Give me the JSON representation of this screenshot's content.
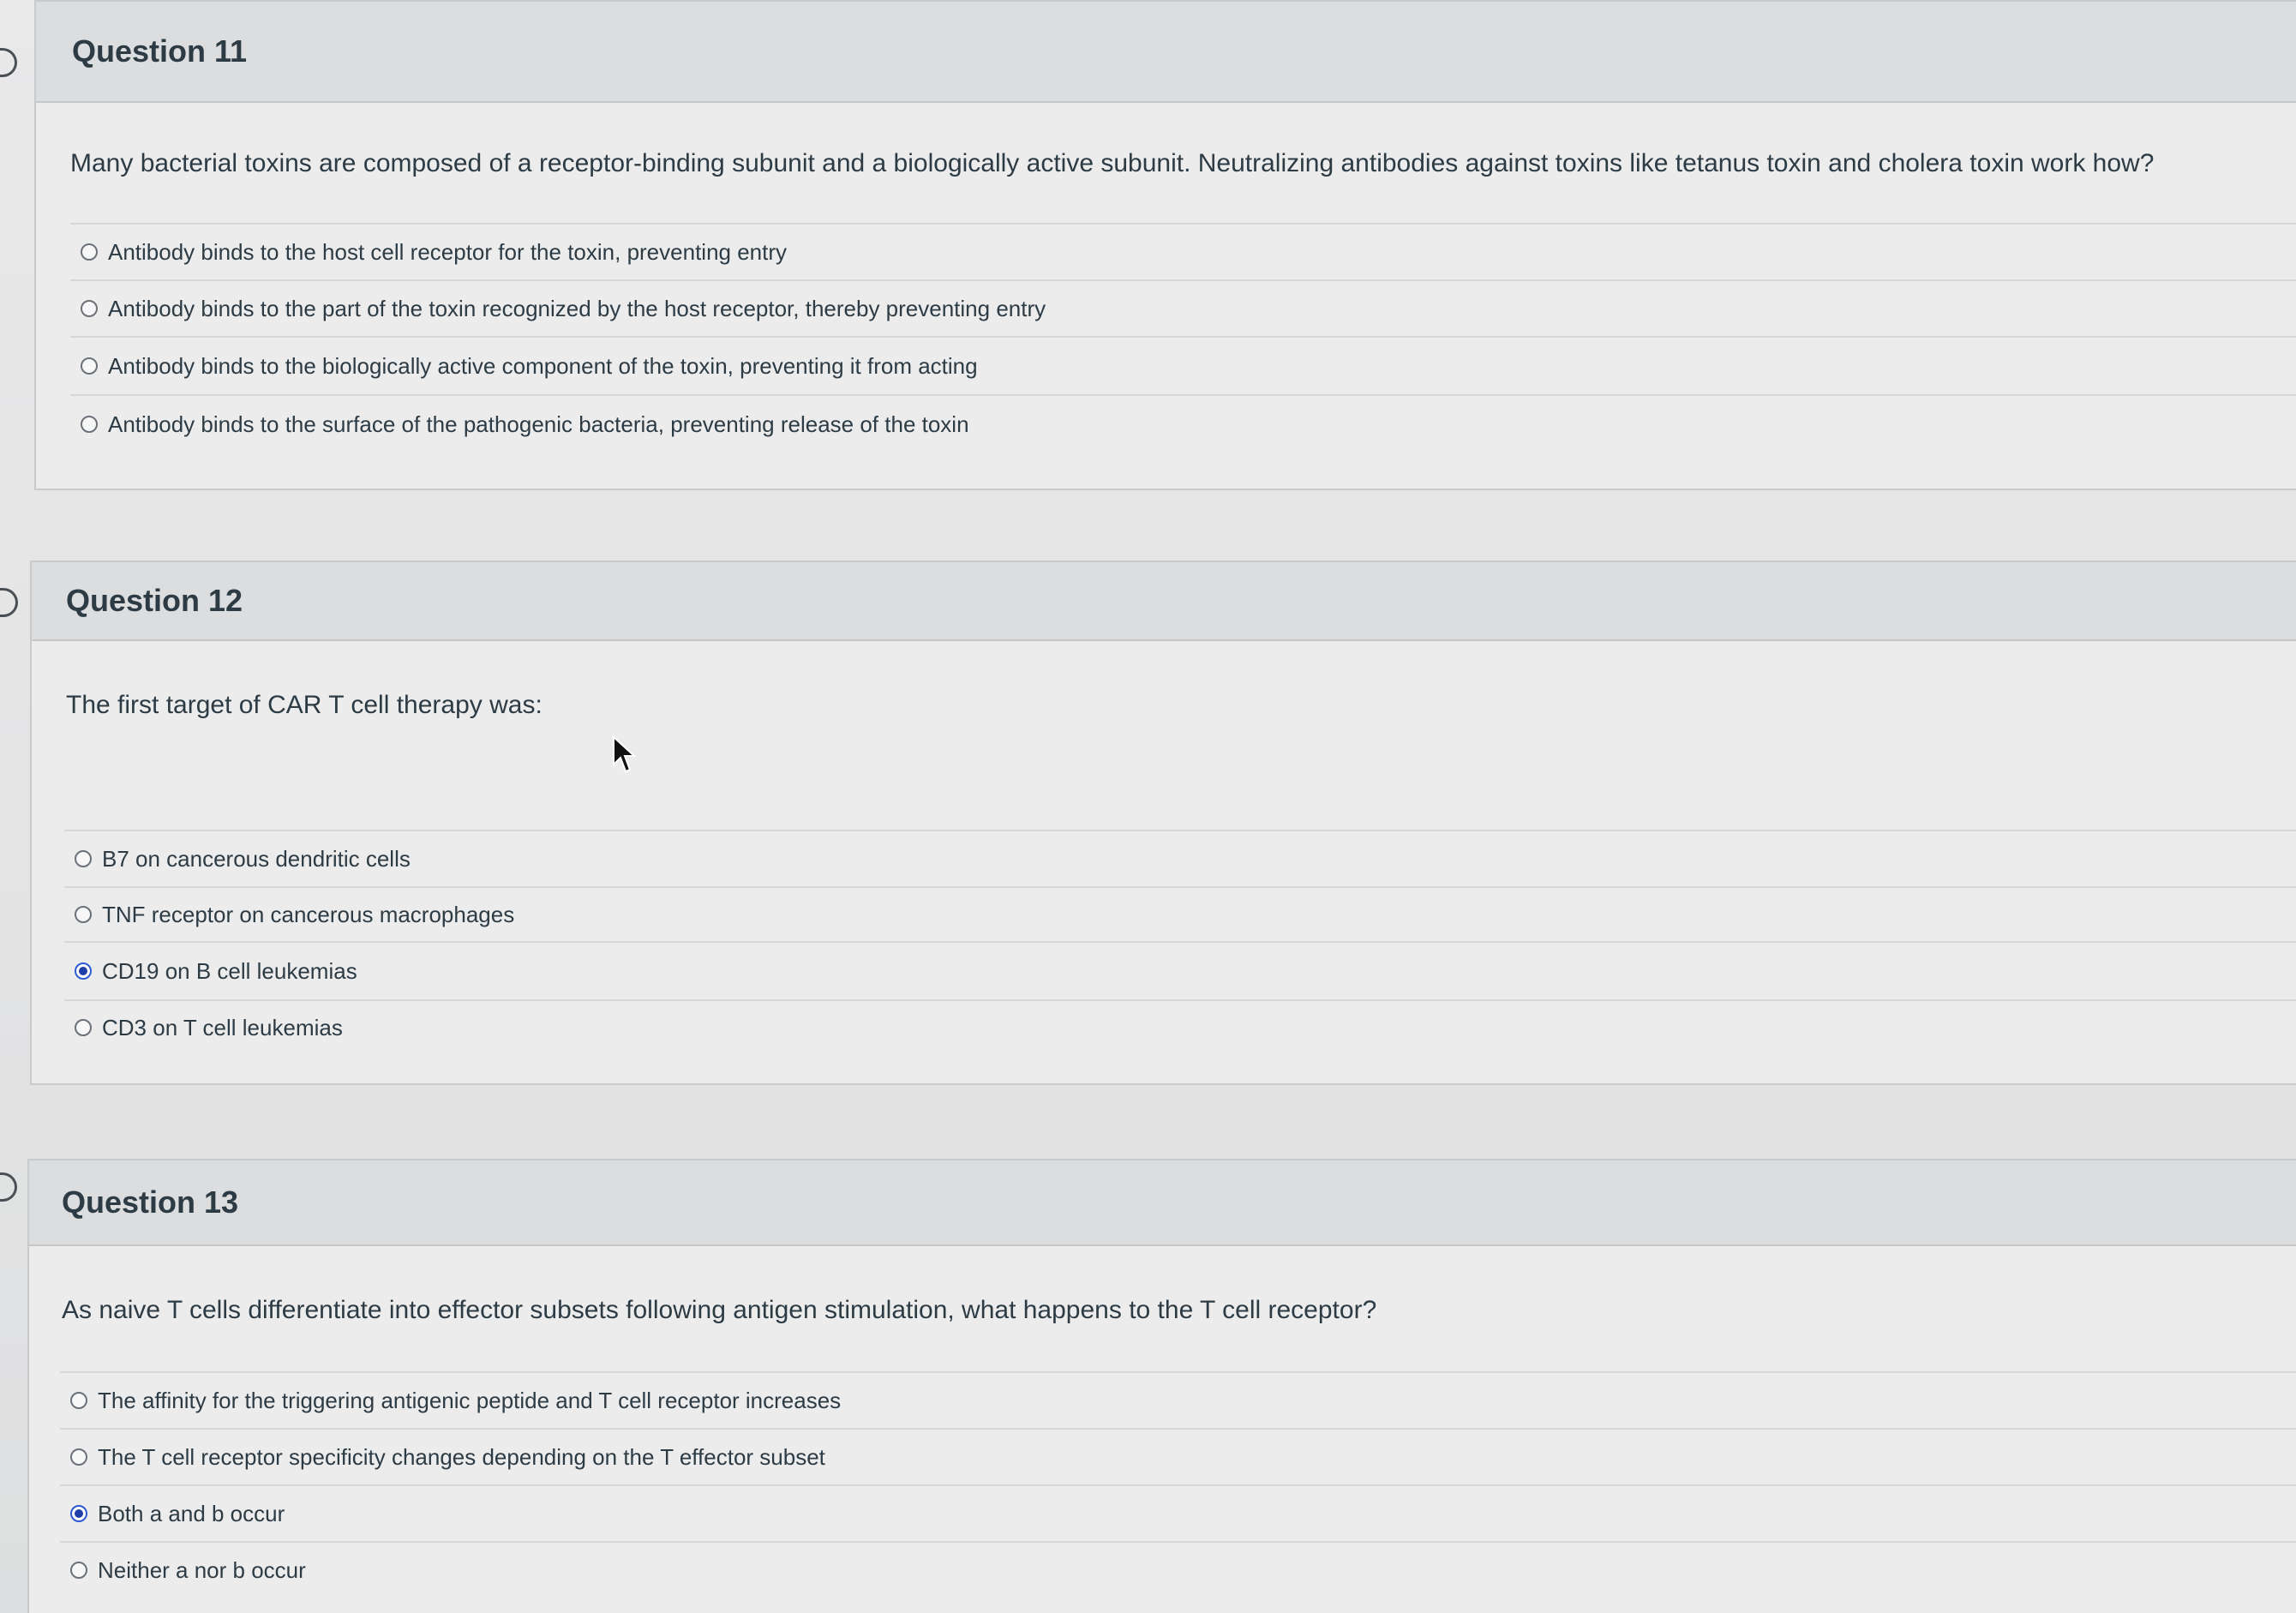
{
  "questions": [
    {
      "title": "Question 11",
      "text": "Many bacterial toxins are composed of a receptor-binding subunit and a biologically active subunit. Neutralizing antibodies against toxins like tetanus toxin and cholera toxin work how?",
      "answers": [
        {
          "label": "Antibody binds to the host cell receptor for the toxin, preventing entry",
          "selected": false
        },
        {
          "label": "Antibody binds to the part of the toxin recognized by the host receptor, thereby preventing entry",
          "selected": false
        },
        {
          "label": "Antibody binds to the biologically active component of the toxin, preventing it from acting",
          "selected": false
        },
        {
          "label": "Antibody binds to the surface of the pathogenic bacteria, preventing release of the toxin",
          "selected": false
        }
      ]
    },
    {
      "title": "Question 12",
      "text": "The first target of CAR T cell therapy was:",
      "answers": [
        {
          "label": "B7 on cancerous dendritic cells",
          "selected": false
        },
        {
          "label": "TNF receptor on cancerous macrophages",
          "selected": false
        },
        {
          "label": "CD19 on B cell leukemias",
          "selected": true
        },
        {
          "label": "CD3 on T cell leukemias",
          "selected": false
        }
      ]
    },
    {
      "title": "Question 13",
      "text": "As naive T cells differentiate into effector subsets following antigen stimulation, what happens to the T cell receptor?",
      "answers": [
        {
          "label": "The affinity for the triggering antigenic peptide and T cell receptor increases",
          "selected": false
        },
        {
          "label": "The T cell receptor specificity changes depending on the T effector subset",
          "selected": false
        },
        {
          "label": "Both a and b occur",
          "selected": true
        },
        {
          "label": "Neither a nor b occur",
          "selected": false
        }
      ]
    }
  ],
  "colors": {
    "selected_radio": "#1f3fa8",
    "header_bg": "#dcdddf",
    "body_bg": "#ececed",
    "text": "#2d3b45"
  }
}
